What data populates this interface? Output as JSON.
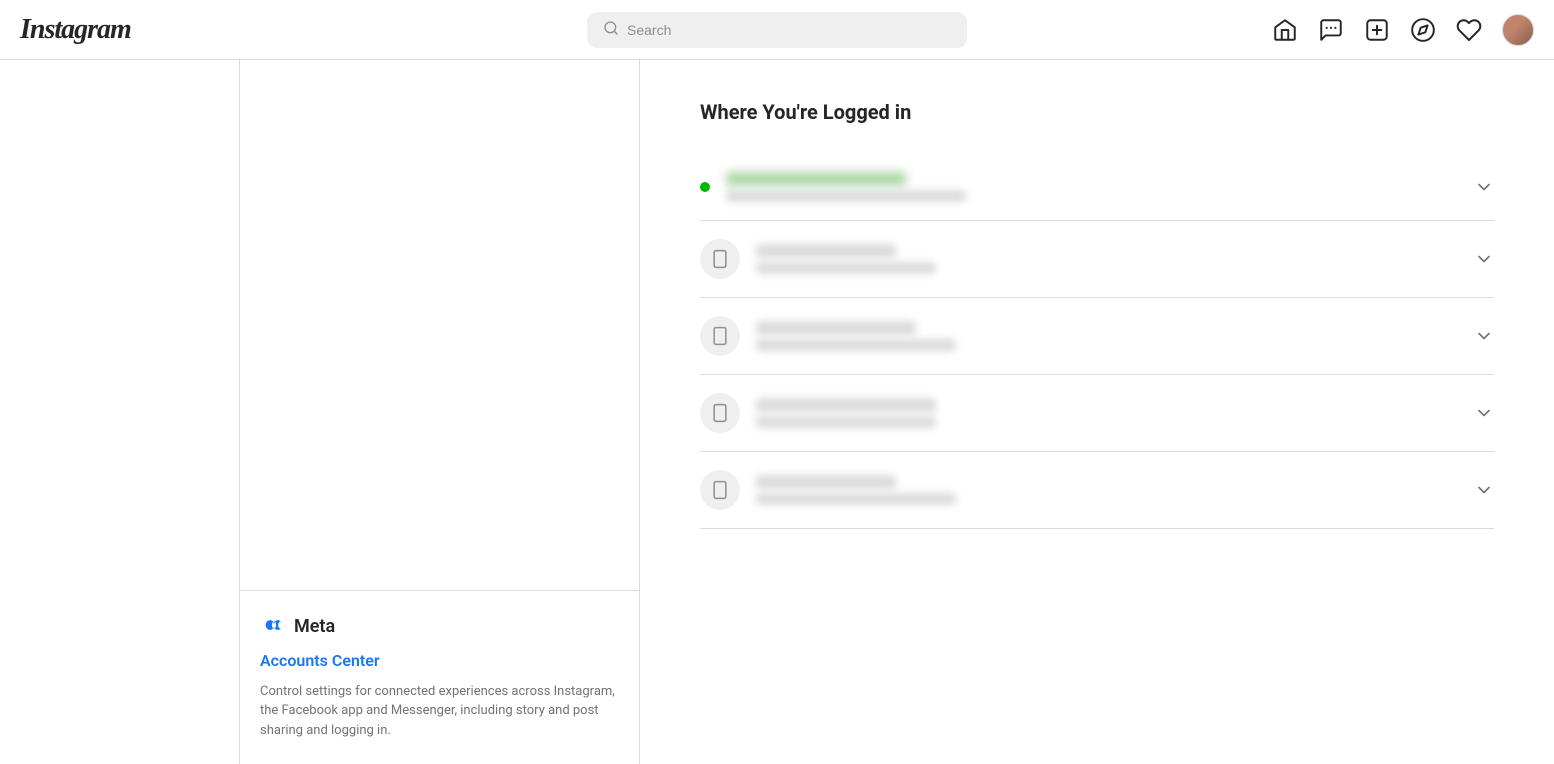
{
  "header": {
    "logo": "Instagram",
    "search_placeholder": "Search",
    "nav_icons": [
      "home",
      "messenger",
      "create",
      "explore",
      "likes"
    ],
    "avatar_label": "Profile"
  },
  "sidebar": {},
  "left_panel": {
    "meta_logo": "∞",
    "meta_brand": "Meta",
    "accounts_center_label": "Accounts Center",
    "meta_description": "Control settings for connected experiences across Instagram, the Facebook app and Messenger, including story and post sharing and logging in."
  },
  "content": {
    "section_title": "Where You're Logged in",
    "login_items": [
      {
        "id": 1,
        "active": true
      },
      {
        "id": 2,
        "active": false
      },
      {
        "id": 3,
        "active": false
      },
      {
        "id": 4,
        "active": false
      },
      {
        "id": 5,
        "active": false
      }
    ]
  }
}
